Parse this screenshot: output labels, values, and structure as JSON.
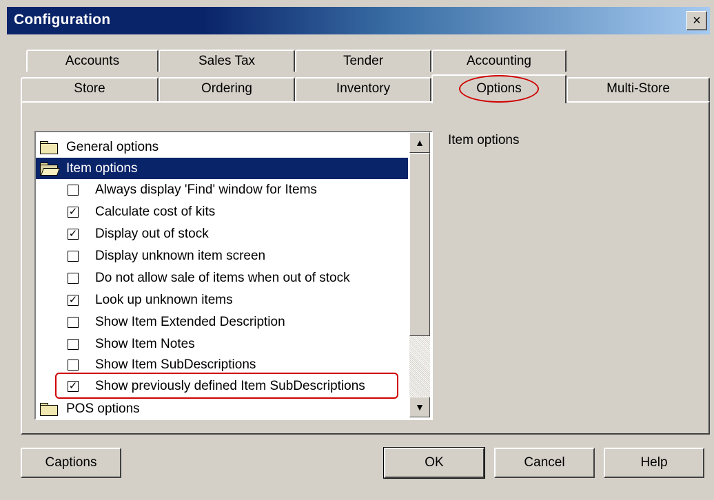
{
  "window": {
    "title": "Configuration",
    "close_label": "×"
  },
  "tabs": {
    "row1": [
      {
        "label": "Accounts"
      },
      {
        "label": "Sales Tax"
      },
      {
        "label": "Tender"
      },
      {
        "label": "Accounting"
      }
    ],
    "row2": [
      {
        "label": "Store"
      },
      {
        "label": "Ordering"
      },
      {
        "label": "Inventory"
      },
      {
        "label": "Options",
        "active": true
      },
      {
        "label": "Multi-Store"
      }
    ]
  },
  "tree": {
    "general_options": "General options",
    "item_options": "Item options",
    "pos_options": "POS options",
    "items": [
      {
        "label": "Always display 'Find' window for Items",
        "checked": false,
        "mark": ""
      },
      {
        "label": "Calculate cost of kits",
        "checked": true,
        "mark": "✓"
      },
      {
        "label": "Display out of stock",
        "checked": true,
        "mark": "✓"
      },
      {
        "label": "Display unknown item screen",
        "checked": false,
        "mark": ""
      },
      {
        "label": "Do not allow sale of items when out of stock",
        "checked": false,
        "mark": ""
      },
      {
        "label": "Look up unknown items",
        "checked": true,
        "mark": "✓"
      },
      {
        "label": "Show Item Extended Description",
        "checked": false,
        "mark": ""
      },
      {
        "label": "Show Item Notes",
        "checked": false,
        "mark": ""
      },
      {
        "label": "Show Item SubDescriptions",
        "checked": false,
        "mark": ""
      },
      {
        "label": "Show previously defined Item SubDescriptions",
        "checked": true,
        "mark": "✓"
      }
    ]
  },
  "side_panel": {
    "label": "Item options"
  },
  "scrollbar": {
    "up_arrow": "▲",
    "down_arrow": "▼"
  },
  "buttons": {
    "captions": "Captions",
    "ok": "OK",
    "cancel": "Cancel",
    "help": "Help"
  },
  "colors": {
    "title_bar": "#0a246a",
    "selection": "#0a246a",
    "highlight_annotation": "#d00000"
  }
}
